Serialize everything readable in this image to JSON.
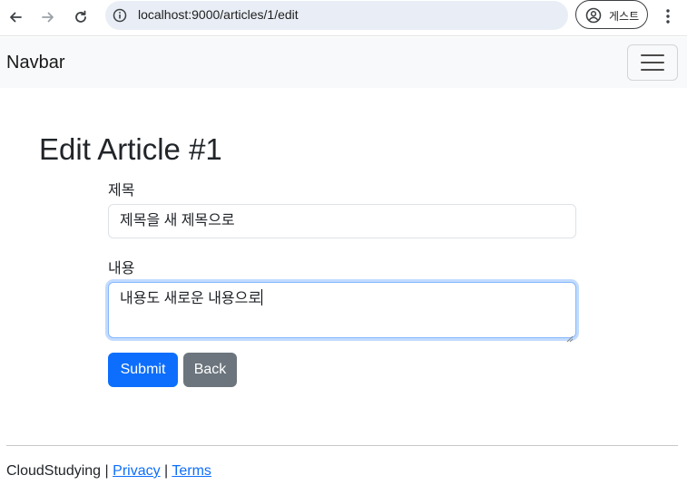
{
  "browser": {
    "url": "localhost:9000/articles/1/edit",
    "profile_label": "게스트"
  },
  "navbar": {
    "brand": "Navbar"
  },
  "page": {
    "title": "Edit Article #1"
  },
  "form": {
    "title_label": "제목",
    "title_value": "제목을 새 제목으로",
    "content_label": "내용",
    "content_value": "내용도 새로운 내용으로",
    "submit_label": "Submit",
    "back_label": "Back"
  },
  "footer": {
    "site_name": "CloudStudying",
    "sep1": "|",
    "privacy": "Privacy",
    "sep2": "|",
    "terms": "Terms"
  },
  "colors": {
    "primary": "#0d6efd",
    "secondary": "#6c757d",
    "navbar_bg": "#f8f9fa",
    "urlbar_bg": "#e9eef6"
  }
}
